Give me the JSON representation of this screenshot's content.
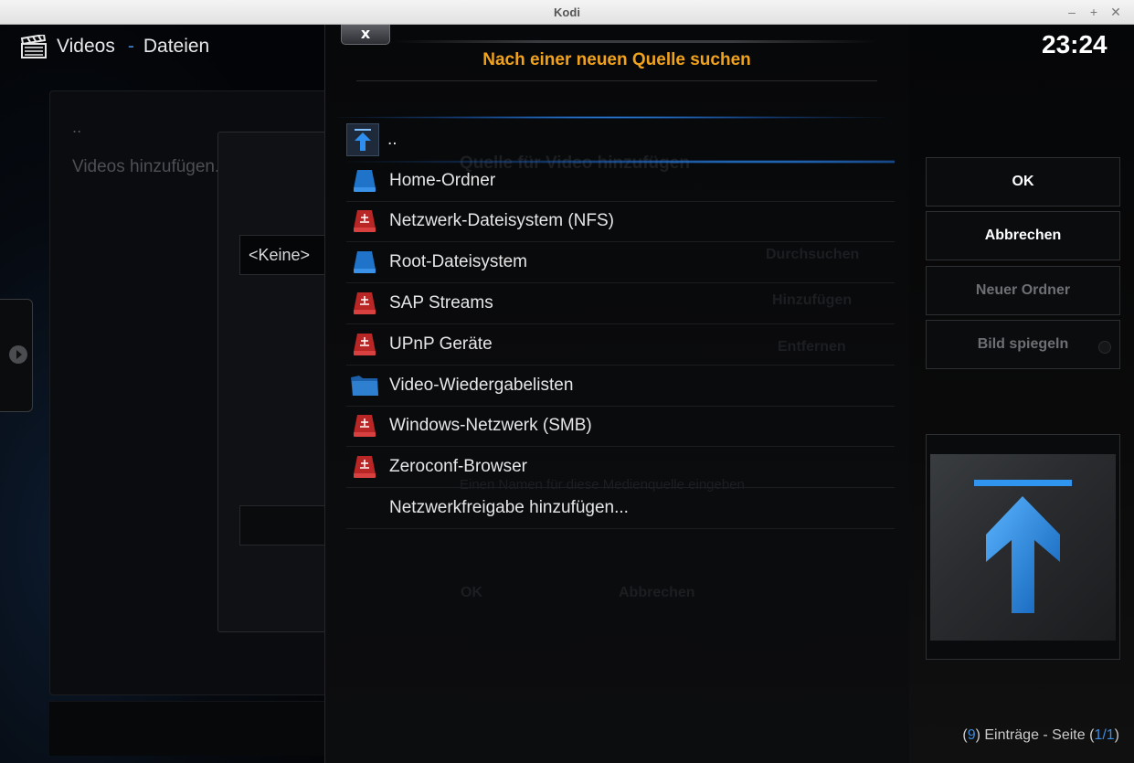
{
  "window": {
    "title": "Kodi"
  },
  "header": {
    "section": "Videos",
    "separator": "-",
    "subsection": "Dateien"
  },
  "clock": "23:24",
  "background": {
    "parent_dots": "..",
    "add_videos": "Videos hinzufügen...",
    "path_value": "<Keine>",
    "ghost_title": "Quelle für Video hinzufügen",
    "ghost_buttons": [
      "Durchsuchen",
      "Hinzufügen",
      "Entfernen"
    ],
    "ghost_hint": "Einen Namen für diese Medienquelle eingeben",
    "ghost_ok": "OK",
    "ghost_cancel": "Abbrechen"
  },
  "dialog": {
    "close_label": "x",
    "title": "Nach einer neuen Quelle suchen",
    "items": [
      {
        "label": "..",
        "icon": "up-arrow-icon"
      },
      {
        "label": "Home-Ordner",
        "icon": "blue-drive-icon"
      },
      {
        "label": "Netzwerk-Dateisystem (NFS)",
        "icon": "network-drive-icon"
      },
      {
        "label": "Root-Dateisystem",
        "icon": "blue-drive-icon"
      },
      {
        "label": "SAP Streams",
        "icon": "network-drive-icon"
      },
      {
        "label": "UPnP Geräte",
        "icon": "network-drive-icon"
      },
      {
        "label": "Video-Wiedergabelisten",
        "icon": "playlist-folder-icon"
      },
      {
        "label": "Windows-Netzwerk (SMB)",
        "icon": "network-drive-icon"
      },
      {
        "label": "Zeroconf-Browser",
        "icon": "network-drive-icon"
      },
      {
        "label": "Netzwerkfreigabe hinzufügen...",
        "icon": ""
      }
    ]
  },
  "buttons": {
    "ok": "OK",
    "cancel": "Abbrechen",
    "new_folder": "Neuer Ordner",
    "flip_image": "Bild spiegeln"
  },
  "footer": {
    "open_paren": "(",
    "count": "9",
    "middle": ") Einträge - Seite (",
    "page": "1/1",
    "close_paren": ")"
  },
  "colors": {
    "accent_orange": "#f0a21c",
    "accent_blue": "#3b8be0",
    "network_red": "#c02a2a",
    "drive_blue": "#1f73c8"
  }
}
